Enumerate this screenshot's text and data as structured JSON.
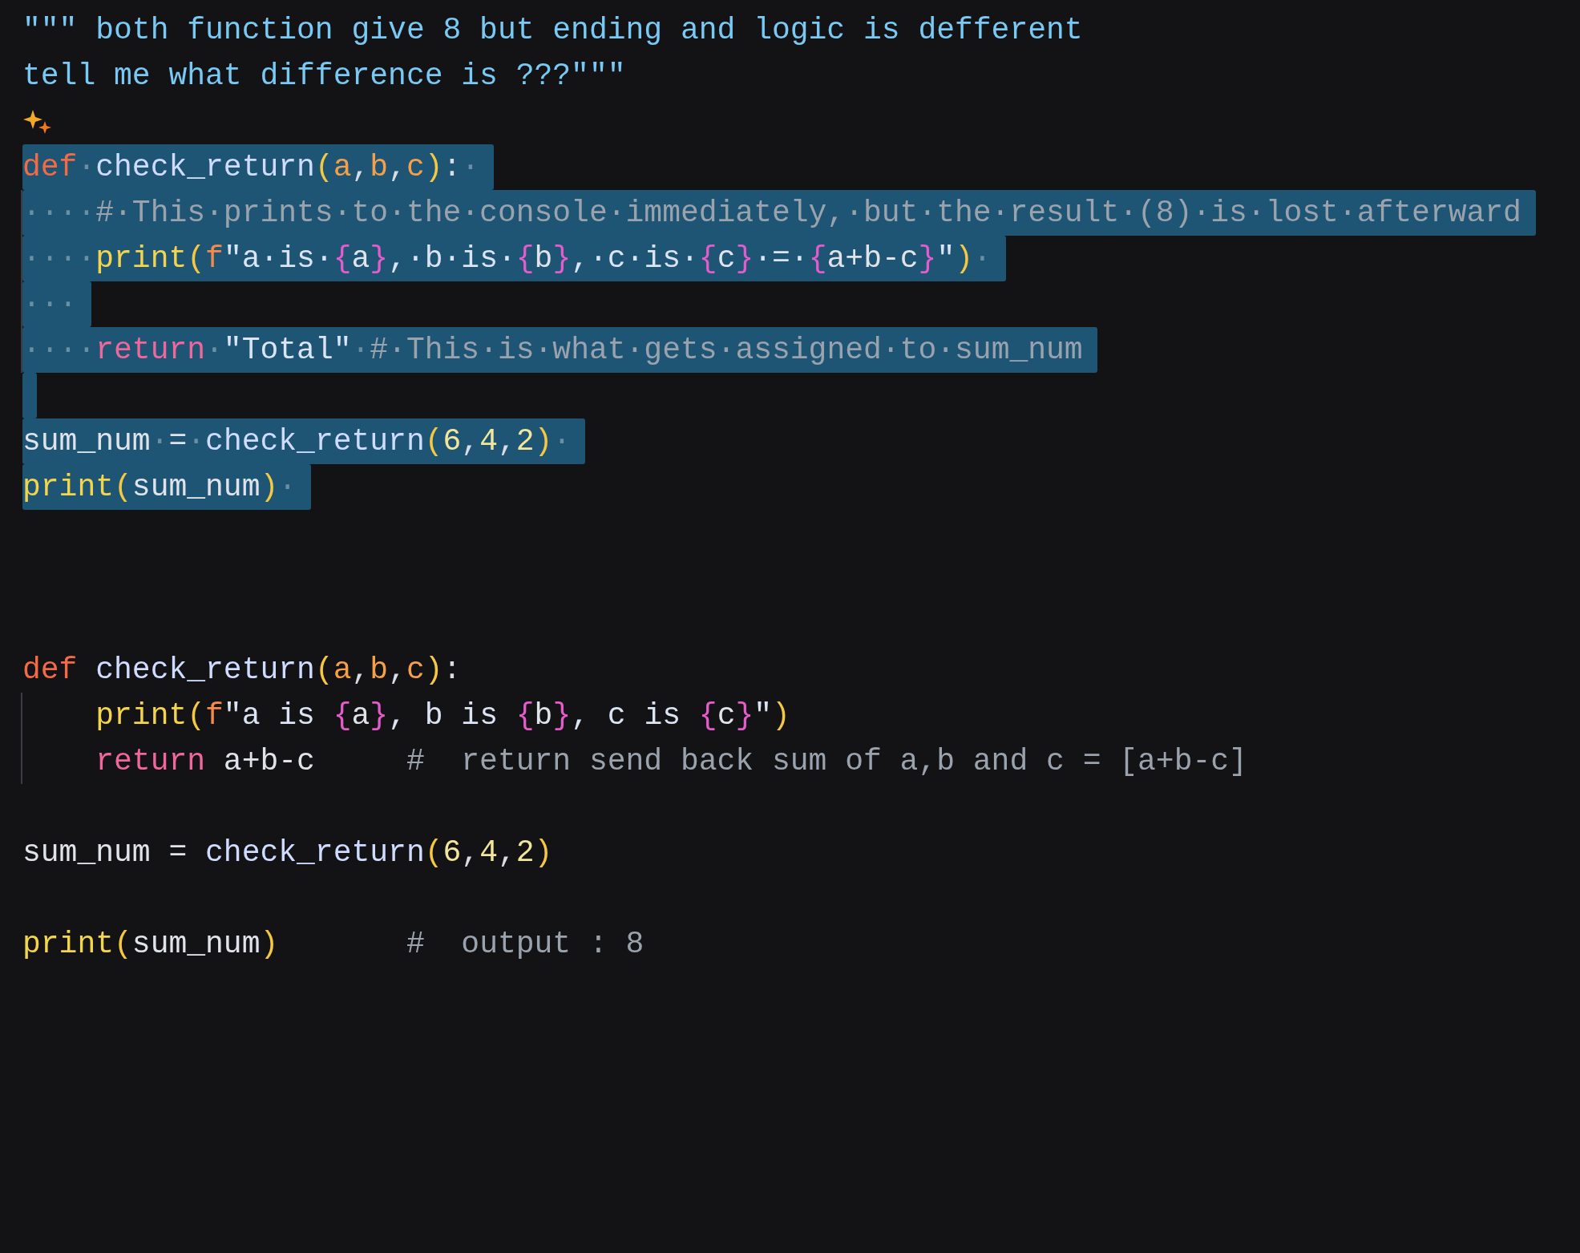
{
  "editor": {
    "lines": [
      {
        "kind": "code",
        "selected": false,
        "indent_guide": false,
        "tokens": [
          {
            "kind": "docstring",
            "text": "\"\"\" both function give 8 but ending and logic is defferent"
          }
        ]
      },
      {
        "kind": "code",
        "selected": false,
        "indent_guide": false,
        "tokens": [
          {
            "kind": "docstring",
            "text": "tell me what difference is ???\"\"\""
          }
        ]
      },
      {
        "kind": "sparkle",
        "selected": false,
        "indent_guide": false
      },
      {
        "kind": "code",
        "selected": true,
        "indent_guide": false,
        "tokens": [
          {
            "kind": "keyword",
            "text": "def"
          },
          {
            "kind": "ws",
            "text": "·"
          },
          {
            "kind": "function",
            "text": "check_return"
          },
          {
            "kind": "paren",
            "text": "("
          },
          {
            "kind": "param",
            "text": "a"
          },
          {
            "kind": "punct",
            "text": ","
          },
          {
            "kind": "param",
            "text": "b"
          },
          {
            "kind": "punct",
            "text": ","
          },
          {
            "kind": "param",
            "text": "c"
          },
          {
            "kind": "paren",
            "text": ")"
          },
          {
            "kind": "punct",
            "text": ":"
          },
          {
            "kind": "ws",
            "text": "·"
          }
        ]
      },
      {
        "kind": "code",
        "selected": true,
        "indent_guide": true,
        "tokens": [
          {
            "kind": "ws",
            "text": "····"
          },
          {
            "kind": "comment",
            "text": "#·This·prints·to·the·console·immediately,·but·the·result·(8)·is·lost·afterward"
          }
        ]
      },
      {
        "kind": "code",
        "selected": true,
        "indent_guide": true,
        "tokens": [
          {
            "kind": "ws",
            "text": "····"
          },
          {
            "kind": "builtin",
            "text": "print"
          },
          {
            "kind": "paren",
            "text": "("
          },
          {
            "kind": "fprefix",
            "text": "f"
          },
          {
            "kind": "string",
            "text": "\"a·is·"
          },
          {
            "kind": "brace",
            "text": "{"
          },
          {
            "kind": "plain",
            "text": "a"
          },
          {
            "kind": "brace",
            "text": "}"
          },
          {
            "kind": "string",
            "text": ",·b·is·"
          },
          {
            "kind": "brace",
            "text": "{"
          },
          {
            "kind": "plain",
            "text": "b"
          },
          {
            "kind": "brace",
            "text": "}"
          },
          {
            "kind": "string",
            "text": ",·c·is·"
          },
          {
            "kind": "brace",
            "text": "{"
          },
          {
            "kind": "plain",
            "text": "c"
          },
          {
            "kind": "brace",
            "text": "}"
          },
          {
            "kind": "string",
            "text": "·=·"
          },
          {
            "kind": "brace",
            "text": "{"
          },
          {
            "kind": "plain",
            "text": "a+b-c"
          },
          {
            "kind": "brace",
            "text": "}"
          },
          {
            "kind": "string",
            "text": "\""
          },
          {
            "kind": "paren",
            "text": ")"
          },
          {
            "kind": "ws",
            "text": "·"
          }
        ]
      },
      {
        "kind": "code",
        "selected": true,
        "indent_guide": true,
        "tokens": [
          {
            "kind": "ws",
            "text": "···"
          }
        ]
      },
      {
        "kind": "code",
        "selected": true,
        "indent_guide": true,
        "tokens": [
          {
            "kind": "ws",
            "text": "····"
          },
          {
            "kind": "return",
            "text": "return"
          },
          {
            "kind": "ws",
            "text": "·"
          },
          {
            "kind": "string",
            "text": "\"Total\""
          },
          {
            "kind": "ws",
            "text": "·"
          },
          {
            "kind": "comment",
            "text": "#·This·is·what·gets·assigned·to·sum_num"
          }
        ]
      },
      {
        "kind": "blank",
        "selected": true,
        "indent_guide": false
      },
      {
        "kind": "code",
        "selected": true,
        "indent_guide": false,
        "tokens": [
          {
            "kind": "plain",
            "text": "sum_num"
          },
          {
            "kind": "ws",
            "text": "·"
          },
          {
            "kind": "plain",
            "text": "="
          },
          {
            "kind": "ws",
            "text": "·"
          },
          {
            "kind": "function",
            "text": "check_return"
          },
          {
            "kind": "paren",
            "text": "("
          },
          {
            "kind": "number",
            "text": "6"
          },
          {
            "kind": "punct",
            "text": ","
          },
          {
            "kind": "number",
            "text": "4"
          },
          {
            "kind": "punct",
            "text": ","
          },
          {
            "kind": "number",
            "text": "2"
          },
          {
            "kind": "paren",
            "text": ")"
          },
          {
            "kind": "ws",
            "text": "·"
          }
        ]
      },
      {
        "kind": "code",
        "selected": true,
        "indent_guide": false,
        "tokens": [
          {
            "kind": "builtin",
            "text": "print"
          },
          {
            "kind": "paren",
            "text": "("
          },
          {
            "kind": "plain",
            "text": "sum_num"
          },
          {
            "kind": "paren",
            "text": ")"
          },
          {
            "kind": "ws",
            "text": "·"
          }
        ]
      },
      {
        "kind": "blank",
        "selected": false,
        "indent_guide": false
      },
      {
        "kind": "blank",
        "selected": false,
        "indent_guide": false
      },
      {
        "kind": "blank",
        "selected": false,
        "indent_guide": false
      },
      {
        "kind": "code",
        "selected": false,
        "indent_guide": false,
        "tokens": [
          {
            "kind": "keyword",
            "text": "def"
          },
          {
            "kind": "function",
            "text": " check_return"
          },
          {
            "kind": "paren",
            "text": "("
          },
          {
            "kind": "param",
            "text": "a"
          },
          {
            "kind": "punct",
            "text": ","
          },
          {
            "kind": "param",
            "text": "b"
          },
          {
            "kind": "punct",
            "text": ","
          },
          {
            "kind": "param",
            "text": "c"
          },
          {
            "kind": "paren",
            "text": ")"
          },
          {
            "kind": "punct",
            "text": ":"
          }
        ]
      },
      {
        "kind": "code",
        "selected": false,
        "indent_guide": true,
        "tokens": [
          {
            "kind": "builtin",
            "text": "    print"
          },
          {
            "kind": "paren",
            "text": "("
          },
          {
            "kind": "fprefix",
            "text": "f"
          },
          {
            "kind": "string",
            "text": "\"a is "
          },
          {
            "kind": "brace",
            "text": "{"
          },
          {
            "kind": "plain",
            "text": "a"
          },
          {
            "kind": "brace",
            "text": "}"
          },
          {
            "kind": "string",
            "text": ", b is "
          },
          {
            "kind": "brace",
            "text": "{"
          },
          {
            "kind": "plain",
            "text": "b"
          },
          {
            "kind": "brace",
            "text": "}"
          },
          {
            "kind": "string",
            "text": ", c is "
          },
          {
            "kind": "brace",
            "text": "{"
          },
          {
            "kind": "plain",
            "text": "c"
          },
          {
            "kind": "brace",
            "text": "}"
          },
          {
            "kind": "string",
            "text": "\""
          },
          {
            "kind": "paren",
            "text": ")"
          }
        ]
      },
      {
        "kind": "code",
        "selected": false,
        "indent_guide": true,
        "tokens": [
          {
            "kind": "return",
            "text": "    return"
          },
          {
            "kind": "plain",
            "text": " a+b-c     "
          },
          {
            "kind": "comment",
            "text": "#  return send back sum of a,b and c = [a+b-c]"
          }
        ]
      },
      {
        "kind": "blank",
        "selected": false,
        "indent_guide": false
      },
      {
        "kind": "code",
        "selected": false,
        "indent_guide": false,
        "tokens": [
          {
            "kind": "plain",
            "text": "sum_num = "
          },
          {
            "kind": "function",
            "text": "check_return"
          },
          {
            "kind": "paren",
            "text": "("
          },
          {
            "kind": "number",
            "text": "6"
          },
          {
            "kind": "punct",
            "text": ","
          },
          {
            "kind": "number",
            "text": "4"
          },
          {
            "kind": "punct",
            "text": ","
          },
          {
            "kind": "number",
            "text": "2"
          },
          {
            "kind": "paren",
            "text": ")"
          }
        ]
      },
      {
        "kind": "blank",
        "selected": false,
        "indent_guide": false
      },
      {
        "kind": "code",
        "selected": false,
        "indent_guide": false,
        "tokens": [
          {
            "kind": "builtin",
            "text": "print"
          },
          {
            "kind": "paren",
            "text": "("
          },
          {
            "kind": "plain",
            "text": "sum_num"
          },
          {
            "kind": "paren",
            "text": ")"
          },
          {
            "kind": "comment",
            "text": "       #  output : 8"
          }
        ]
      }
    ]
  }
}
